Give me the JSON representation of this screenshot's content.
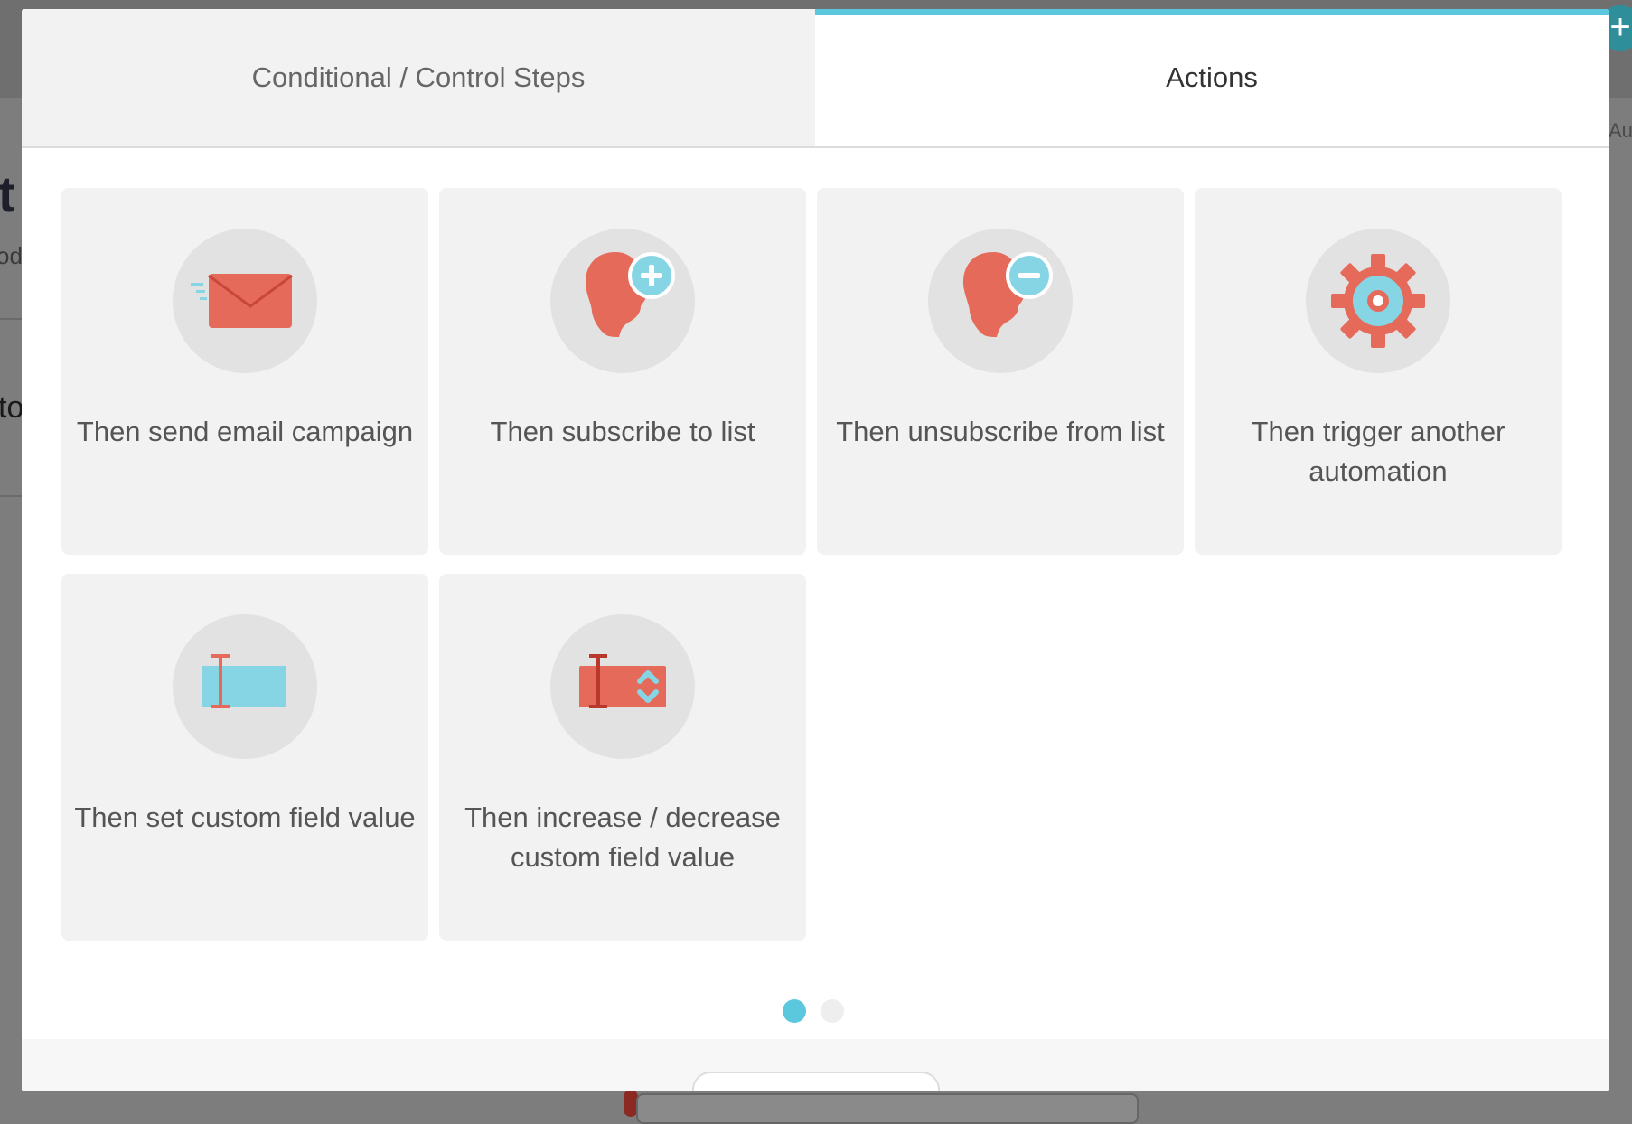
{
  "background": {
    "heading_fragment": "t",
    "sub_fragment": "od",
    "text_fragment": "to",
    "right_fragment": "Au",
    "plus_symbol": "+"
  },
  "tabs": [
    {
      "label": "Conditional / Control Steps",
      "active": false
    },
    {
      "label": "Actions",
      "active": true
    }
  ],
  "actions": [
    {
      "label": "Then send email campaign",
      "icon": "envelope-icon"
    },
    {
      "label": "Then subscribe to list",
      "icon": "subscribe-head-icon"
    },
    {
      "label": "Then unsubscribe from list",
      "icon": "unsubscribe-head-icon"
    },
    {
      "label": "Then trigger another automation",
      "icon": "gear-icon"
    },
    {
      "label": "Then set custom field value",
      "icon": "text-field-icon"
    },
    {
      "label": "Then increase / decrease custom field value",
      "icon": "number-stepper-field-icon"
    }
  ],
  "pagination": {
    "total_pages": 2,
    "current_page": 1
  },
  "colors": {
    "accent": "#5bc8de",
    "icon_red": "#e66a5a",
    "icon_blue": "#86d5e5",
    "card_bg": "#f2f2f2",
    "circle_bg": "#e2e2e2"
  }
}
